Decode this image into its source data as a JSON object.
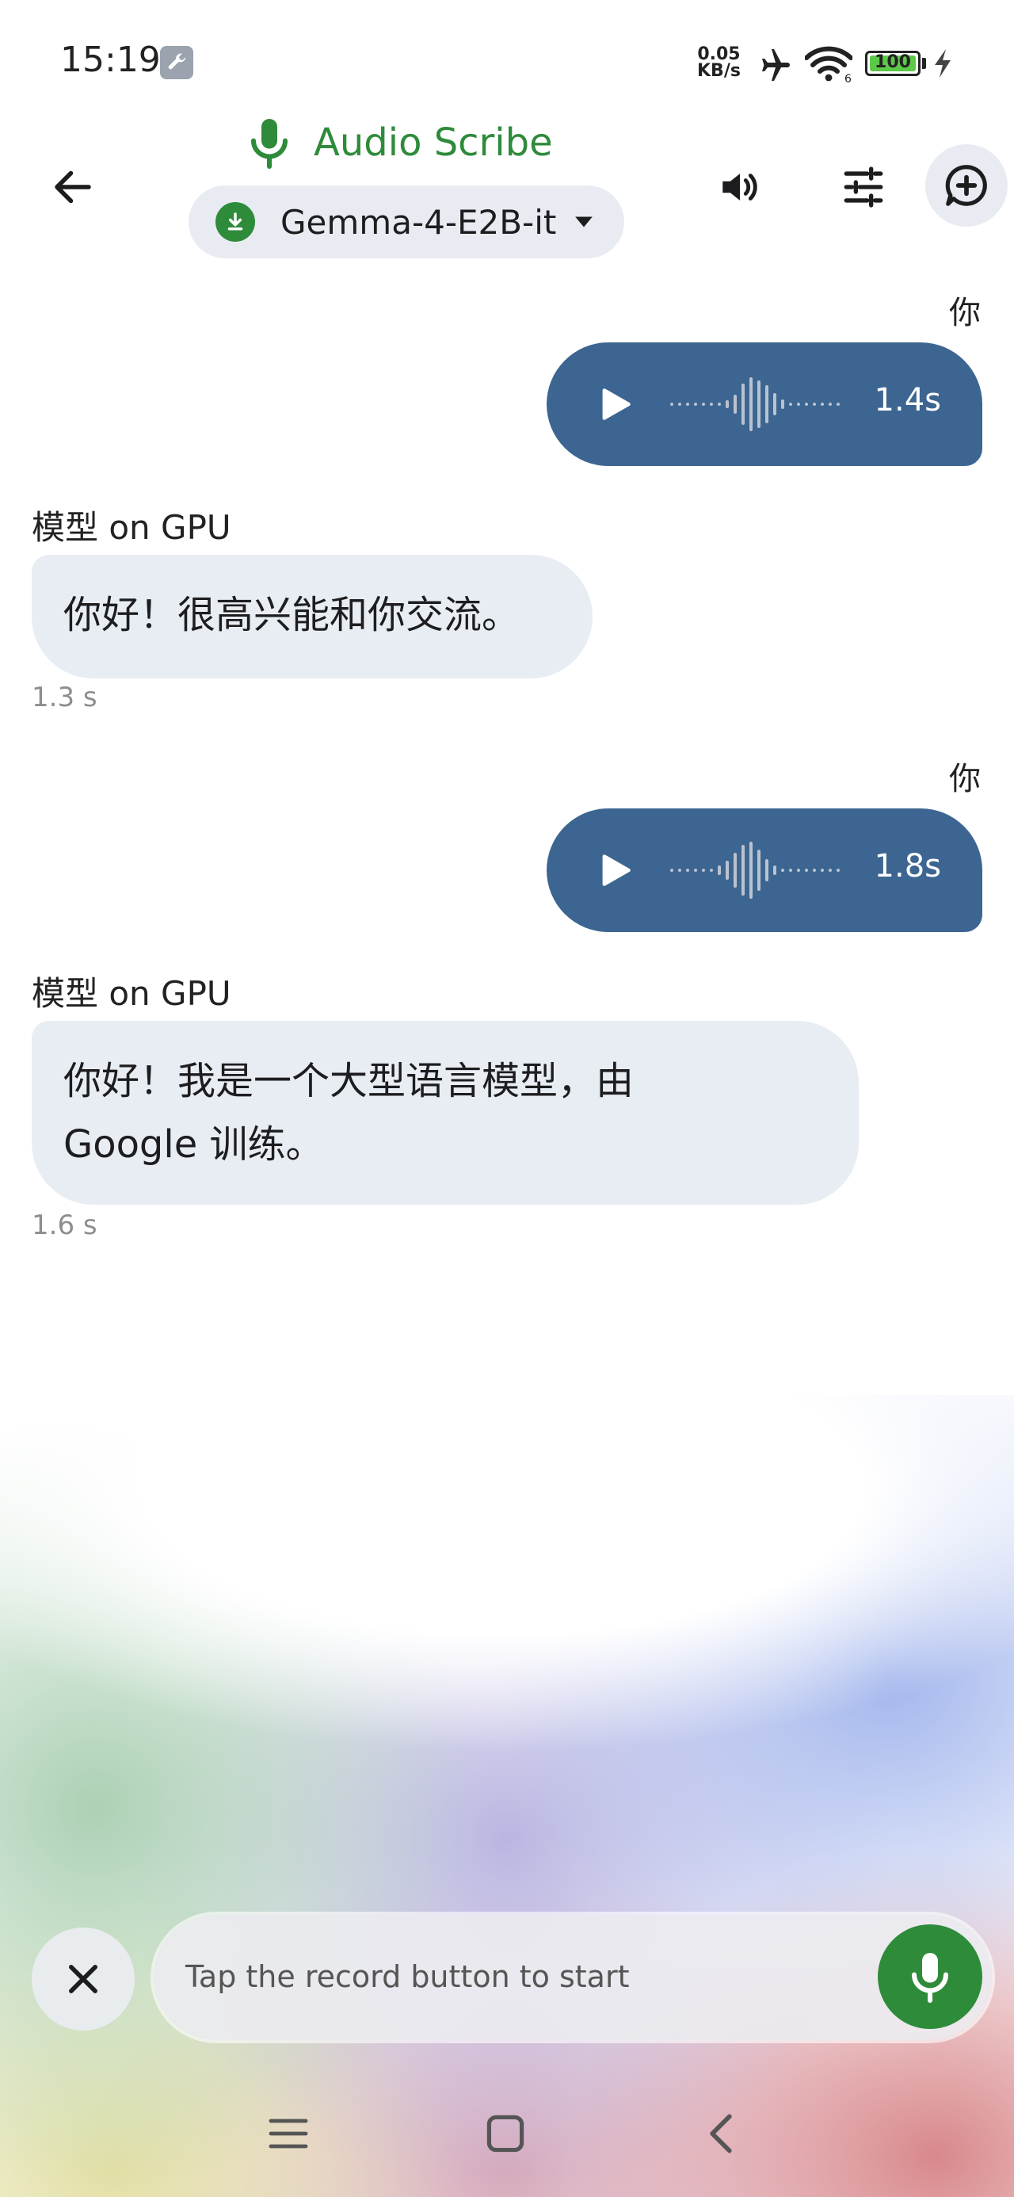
{
  "status_bar": {
    "time": "15:19",
    "net_speed_value": "0.05",
    "net_speed_unit": "KB/s",
    "battery": "100",
    "battery_level": 1.0,
    "icons": [
      "wrench-icon",
      "airplane-icon",
      "wifi-icon",
      "battery-icon",
      "charging-icon"
    ]
  },
  "header": {
    "title": "Audio Scribe",
    "model_name": "Gemma-4-E2B-it",
    "accent_color": "#2e8b3a",
    "icons": [
      "back-arrow-icon",
      "mic-icon",
      "download-icon",
      "caret-down-icon",
      "volume-icon",
      "sliders-icon",
      "add-chat-icon"
    ]
  },
  "chat": {
    "messages": [
      {
        "role": "user",
        "sender": "你",
        "type": "audio",
        "duration": "1.4s"
      },
      {
        "role": "model",
        "sender": "模型 on GPU",
        "text_lines": [
          "你好！很高兴能和你交流。"
        ],
        "latency": "1.3 s"
      },
      {
        "role": "user",
        "sender": "你",
        "type": "audio",
        "duration": "1.8s"
      },
      {
        "role": "model",
        "sender": "模型 on GPU",
        "text_lines": [
          "你好！我是一个大型语言模型，由",
          "Google 训练。"
        ],
        "latency": "1.6 s"
      }
    ],
    "user_bubble_color": "#3d6591",
    "model_bubble_color": "#e8ecf3"
  },
  "input": {
    "placeholder": "Tap the record button to start",
    "icons": [
      "close-icon",
      "mic-icon"
    ]
  },
  "nav_bar": {
    "icons": [
      "menu-icon",
      "home-icon",
      "back-icon"
    ]
  }
}
